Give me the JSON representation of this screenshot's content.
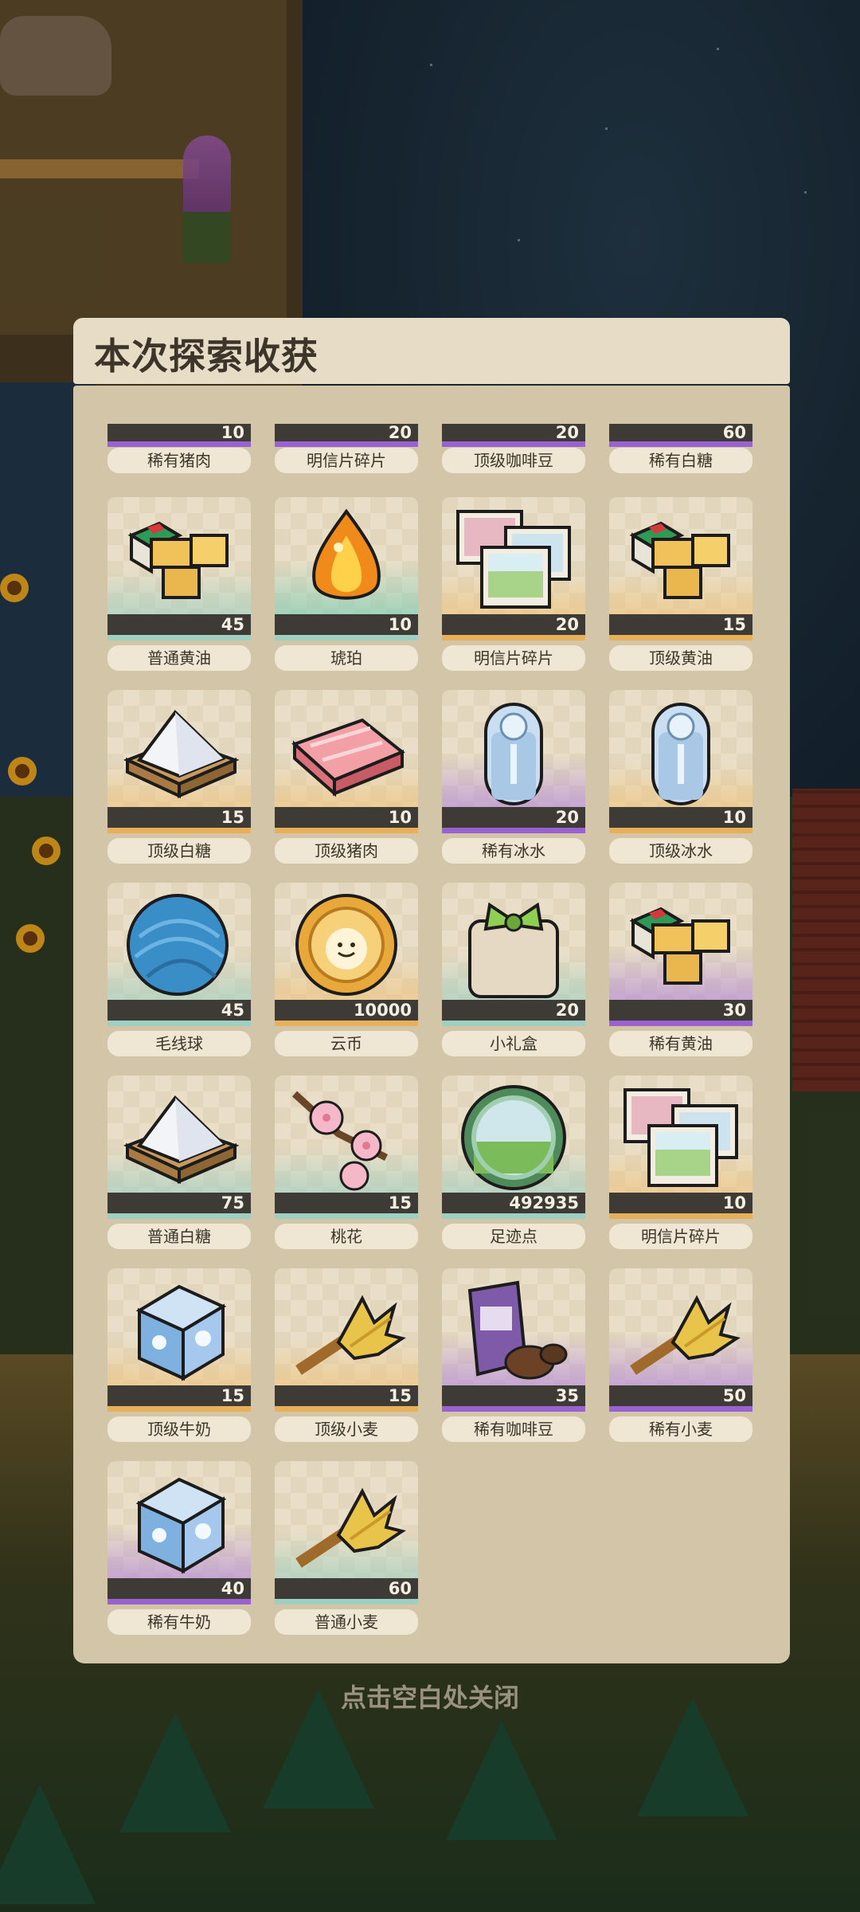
{
  "modal": {
    "title": "本次探索收获",
    "close_hint": "点击空白处关闭"
  },
  "partial_row": [
    {
      "name": "稀有猪肉",
      "qty": "10",
      "rarity": "rare"
    },
    {
      "name": "明信片碎片",
      "qty": "20",
      "rarity": "rare"
    },
    {
      "name": "顶级咖啡豆",
      "qty": "20",
      "rarity": "rare"
    },
    {
      "name": "稀有白糖",
      "qty": "60",
      "rarity": "rare"
    }
  ],
  "items": [
    {
      "name": "普通黄油",
      "qty": "45",
      "rarity": "common",
      "icon": "butter-icon"
    },
    {
      "name": "琥珀",
      "qty": "10",
      "rarity": "amber",
      "icon": "amber-icon"
    },
    {
      "name": "明信片碎片",
      "qty": "20",
      "rarity": "top",
      "icon": "postcard-icon"
    },
    {
      "name": "顶级黄油",
      "qty": "15",
      "rarity": "top",
      "icon": "butter-icon"
    },
    {
      "name": "顶级白糖",
      "qty": "15",
      "rarity": "top",
      "icon": "sugar-icon"
    },
    {
      "name": "顶级猪肉",
      "qty": "10",
      "rarity": "top",
      "icon": "pork-icon"
    },
    {
      "name": "稀有冰水",
      "qty": "20",
      "rarity": "rare",
      "icon": "ice-water-icon"
    },
    {
      "name": "顶级冰水",
      "qty": "10",
      "rarity": "top",
      "icon": "ice-water-icon"
    },
    {
      "name": "毛线球",
      "qty": "45",
      "rarity": "common",
      "icon": "yarn-ball-icon"
    },
    {
      "name": "云币",
      "qty": "10000",
      "rarity": "top",
      "icon": "cloud-coin-icon"
    },
    {
      "name": "小礼盒",
      "qty": "20",
      "rarity": "common",
      "icon": "gift-box-icon"
    },
    {
      "name": "稀有黄油",
      "qty": "30",
      "rarity": "rare",
      "icon": "butter-icon"
    },
    {
      "name": "普通白糖",
      "qty": "75",
      "rarity": "common",
      "icon": "sugar-icon"
    },
    {
      "name": "桃花",
      "qty": "15",
      "rarity": "common",
      "icon": "peach-blossom-icon"
    },
    {
      "name": "足迹点",
      "qty": "492935",
      "rarity": "common",
      "icon": "footprint-orb-icon"
    },
    {
      "name": "明信片碎片",
      "qty": "10",
      "rarity": "top",
      "icon": "postcard-icon"
    },
    {
      "name": "顶级牛奶",
      "qty": "15",
      "rarity": "top",
      "icon": "milk-icon"
    },
    {
      "name": "顶级小麦",
      "qty": "15",
      "rarity": "top",
      "icon": "wheat-icon"
    },
    {
      "name": "稀有咖啡豆",
      "qty": "35",
      "rarity": "rare",
      "icon": "coffee-bean-icon"
    },
    {
      "name": "稀有小麦",
      "qty": "50",
      "rarity": "rare",
      "icon": "wheat-icon"
    },
    {
      "name": "稀有牛奶",
      "qty": "40",
      "rarity": "rare",
      "icon": "milk-icon"
    },
    {
      "name": "普通小麦",
      "qty": "60",
      "rarity": "common",
      "icon": "wheat-icon"
    }
  ],
  "colors": {
    "common": "#9fcfc0",
    "top": "#e8b05a",
    "rare": "#9a62d0",
    "modal_bg": "#d3c6a8",
    "header_bg": "#e7ddc6"
  }
}
